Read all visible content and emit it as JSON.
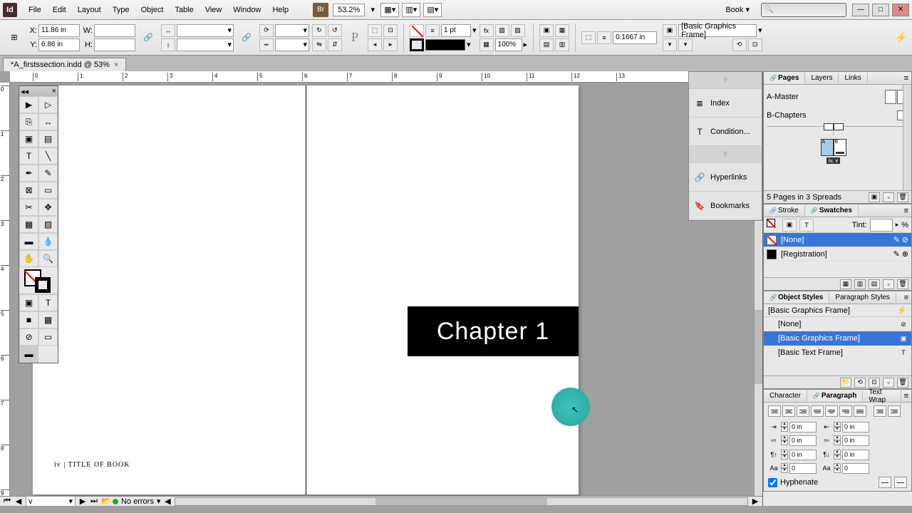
{
  "menubar": {
    "logo": "Id",
    "items": [
      "File",
      "Edit",
      "Layout",
      "Type",
      "Object",
      "Table",
      "View",
      "Window",
      "Help"
    ],
    "bridge": "Br",
    "zoom": "53.2%",
    "workspace": "Book"
  },
  "controlbar": {
    "x": "11.86 in",
    "y": "6.86 in",
    "w": "",
    "h": "",
    "stroke_weight": "1 pt",
    "fill_pct": "100%",
    "ref_value": "0.1667 in",
    "object_style": "[Basic Graphics Frame]"
  },
  "doc_tab": {
    "name": "*A_firstssection.indd @ 53%",
    "close": "×"
  },
  "canvas": {
    "chapter_text": "Chapter 1",
    "footer_text": "iv | TITLE OF BOOK"
  },
  "status": {
    "page": "v",
    "errors": "No errors"
  },
  "dock": {
    "items": [
      "Index",
      "Condition...",
      "Hyperlinks",
      "Bookmarks"
    ]
  },
  "pages_panel": {
    "tabs": [
      "Pages",
      "Layers",
      "Links"
    ],
    "masters": [
      "A-Master",
      "B-Chapters"
    ],
    "footer": "5 Pages in 3 Spreads",
    "spread_label": "iv, v"
  },
  "swatches_panel": {
    "tabs": [
      "Stroke",
      "Swatches"
    ],
    "tint_label": "Tint:",
    "tint_unit": "%",
    "rows": [
      {
        "name": "[None]",
        "type": "none"
      },
      {
        "name": "[Registration]",
        "type": "reg"
      }
    ]
  },
  "objstyles_panel": {
    "tabs": [
      "Object Styles",
      "Paragraph Styles"
    ],
    "header": "[Basic Graphics Frame]",
    "rows": [
      {
        "name": "[None]",
        "selected": false
      },
      {
        "name": "[Basic Graphics Frame]",
        "selected": true
      },
      {
        "name": "[Basic Text Frame]",
        "selected": false
      }
    ]
  },
  "para_panel": {
    "tabs": [
      "Character",
      "Paragraph",
      "Text Wrap"
    ],
    "indent_left": "0 in",
    "indent_right": "0 in",
    "first_line": "0 in",
    "last_line": "0 in",
    "space_before": "0 in",
    "space_after": "0 in",
    "dropcap_lines": "0",
    "dropcap_chars": "0",
    "hyphenate": "Hyphenate"
  },
  "ruler_h_ticks": [
    0,
    1,
    2,
    3,
    4,
    5,
    6,
    7,
    8,
    9,
    10,
    11,
    12,
    13
  ],
  "ruler_v_ticks": [
    0,
    1,
    2,
    3,
    4,
    5,
    6,
    7,
    8,
    9
  ]
}
